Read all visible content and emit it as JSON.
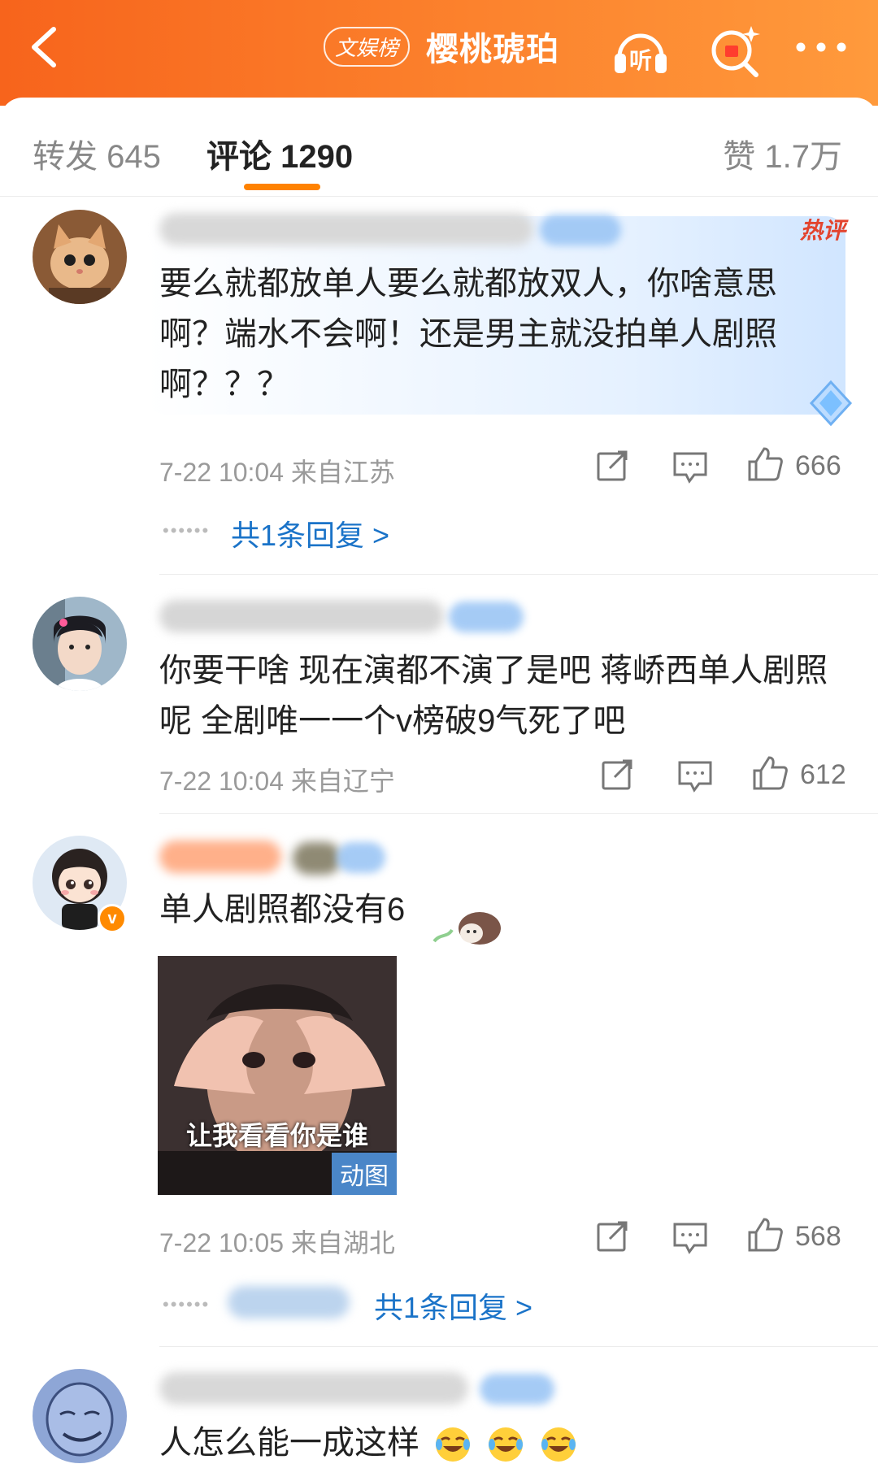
{
  "header": {
    "badge": "文娱榜",
    "title": "樱桃琥珀",
    "listen_glyph": "听",
    "more_glyph": "•••"
  },
  "tabs": {
    "repost": "转发 645",
    "comments": "评论 1290",
    "likes": "赞 1.7万"
  },
  "comments": [
    {
      "badge": "热评",
      "lines": [
        "要么就都放单人要么就都放双人，你啥意思",
        "啊？端水不会啊！还是男主就没拍单人剧照",
        "啊？？？"
      ],
      "meta": "7-22 10:04 来自江苏",
      "likes": "666",
      "replies": "共1条回复 >"
    },
    {
      "lines": [
        "你要干啥 现在演都不演了是吧 蒋峤西单人剧照",
        "呢 全剧唯一一个v榜破9气死了吧"
      ],
      "meta": "7-22 10:04 来自辽宁",
      "likes": "612"
    },
    {
      "lines": [
        "单人剧照都没有6"
      ],
      "gif_caption": "让我看看你是谁",
      "gif_tag": "动图",
      "meta": "7-22 10:05 来自湖北",
      "likes": "568",
      "replies": "共1条回复 >"
    },
    {
      "lines": [
        "人怎么能一成这样"
      ]
    }
  ],
  "icons": [
    "back-arrow-icon",
    "listen-icon",
    "search-icon",
    "more-icon",
    "share-icon",
    "comment-icon",
    "like-icon",
    "laugh-cry-emoji"
  ],
  "colors": {
    "header_start": "#f7641c",
    "header_end": "#ff9a3c",
    "accent": "#ff8200",
    "link": "#1a73c8",
    "hot": "#e3442e"
  }
}
